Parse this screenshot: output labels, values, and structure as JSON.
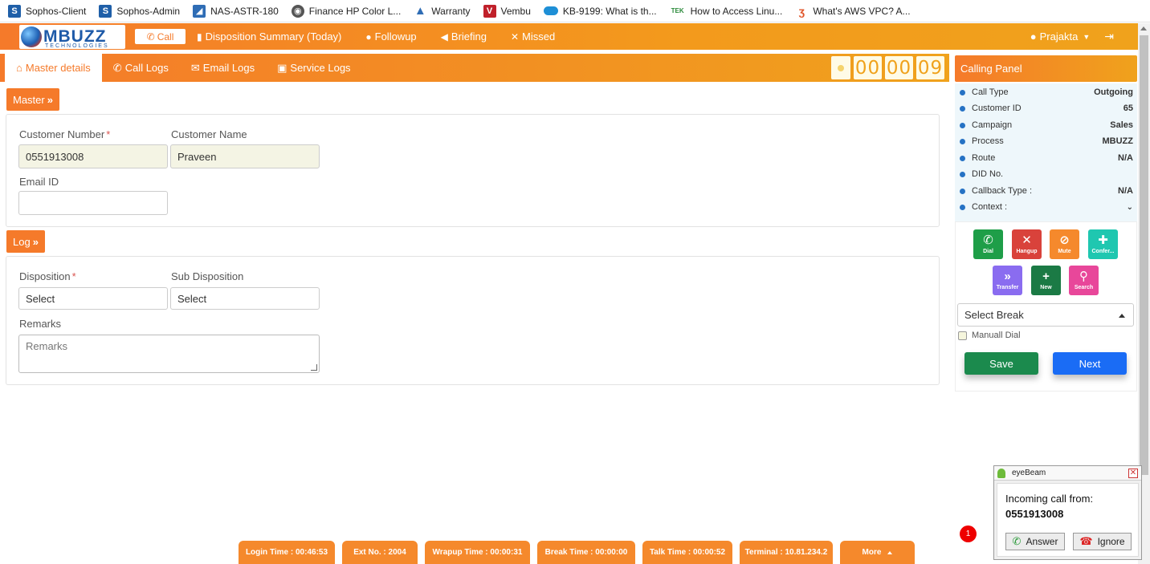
{
  "bookmarks": [
    {
      "label": "Sophos-Client",
      "icon": "sophos-icon",
      "color": "#1f5fa8"
    },
    {
      "label": "Sophos-Admin",
      "icon": "sophos-icon",
      "color": "#1f5fa8"
    },
    {
      "label": "NAS-ASTR-180",
      "icon": "nas-icon",
      "color": "#2f6db5"
    },
    {
      "label": "Finance HP Color L...",
      "icon": "globe-icon",
      "color": "#555555"
    },
    {
      "label": "Warranty",
      "icon": "warranty-icon",
      "color": "#2f6db5"
    },
    {
      "label": "Vembu",
      "icon": "vembu-icon",
      "color": "#c0202a"
    },
    {
      "label": "KB-9199: What is th...",
      "icon": "cloud-icon",
      "color": "#1e8fd6"
    },
    {
      "label": "How to Access Linu...",
      "icon": "tek-icon",
      "color": "#2a8a3a"
    },
    {
      "label": "What's AWS VPC? A...",
      "icon": "aws-icon",
      "color": "#e0552a"
    }
  ],
  "nav": {
    "logo_text": "MBUZZ",
    "logo_sub": "TECHNOLOGIES",
    "call_label": "Call",
    "links": [
      "Disposition Summary (Today)",
      "Followup",
      "Briefing",
      "Missed"
    ],
    "user": "Prajakta"
  },
  "tabs": [
    "Master details",
    "Call Logs",
    "Email Logs",
    "Service Logs"
  ],
  "timer": [
    "00",
    "00",
    "09"
  ],
  "master": {
    "section_label": "Master",
    "customer_number_label": "Customer Number",
    "customer_number_value": "0551913008",
    "customer_name_label": "Customer Name",
    "customer_name_value": "Praveen",
    "email_label": "Email ID",
    "email_value": ""
  },
  "log": {
    "section_label": "Log",
    "disposition_label": "Disposition",
    "disposition_value": "Select",
    "sub_disposition_label": "Sub Disposition",
    "sub_disposition_value": "Select",
    "remarks_label": "Remarks",
    "remarks_placeholder": "Remarks"
  },
  "calling_panel": {
    "title": "Calling Panel",
    "rows": [
      {
        "label": "Call Type",
        "value": "Outgoing"
      },
      {
        "label": "Customer ID",
        "value": "65"
      },
      {
        "label": "Campaign",
        "value": "Sales"
      },
      {
        "label": "Process",
        "value": "MBUZZ"
      },
      {
        "label": "Route",
        "value": "N/A"
      },
      {
        "label": "DID No.",
        "value": ""
      },
      {
        "label": "Callback Type :",
        "value": "N/A"
      },
      {
        "label": "Context :",
        "value": ""
      }
    ],
    "actions": [
      {
        "label": "Dial",
        "color": "#1e9e48"
      },
      {
        "label": "Hangup",
        "color": "#d9423b"
      },
      {
        "label": "Mute",
        "color": "#f5892c"
      },
      {
        "label": "Confer...",
        "color": "#1fc7b0"
      },
      {
        "label": "Transfer",
        "color": "#8a6cf0"
      },
      {
        "label": "New",
        "color": "#1b7a45"
      },
      {
        "label": "Search",
        "color": "#e8479a"
      }
    ],
    "break_select": "Select Break",
    "manual_dial": "Manuall Dial",
    "save_label": "Save",
    "next_label": "Next"
  },
  "eyebeam": {
    "title": "eyeBeam",
    "line1": "Incoming call from:",
    "number": "0551913008",
    "answer": "Answer",
    "ignore": "Ignore"
  },
  "notification_count": "1",
  "status_bar": [
    "Login Time : 00:46:53",
    "Ext No. : 2004",
    "Wrapup Time : 00:00:31",
    "Break Time : 00:00:00",
    "Talk Time : 00:00:52",
    "Terminal : 10.81.234.2",
    "More"
  ]
}
